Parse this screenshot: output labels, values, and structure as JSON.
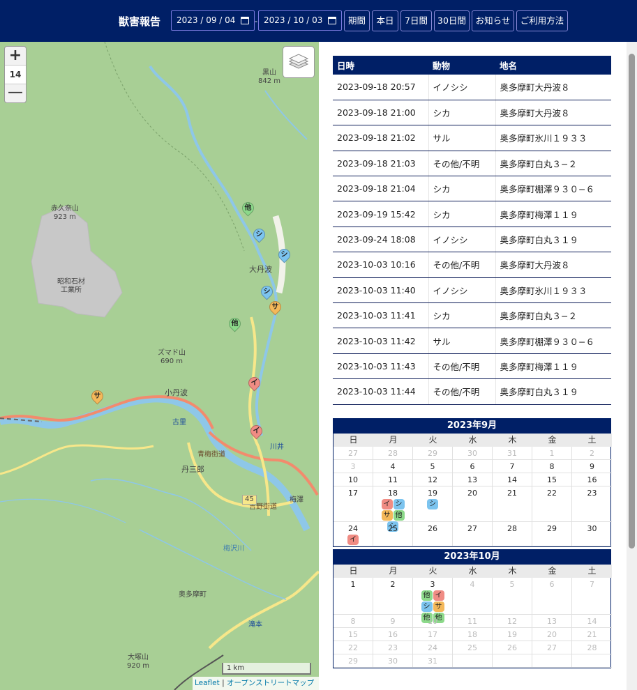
{
  "header": {
    "title": "獣害報告",
    "date_from": "2023 / 09 / 04",
    "date_separator": "-",
    "date_to": "2023 / 10 / 03",
    "buttons": [
      "期間",
      "本日",
      "7日間",
      "30日間",
      "お知らせ",
      "ご利用方法"
    ]
  },
  "map": {
    "zoom_in": "+",
    "zoom_level": "14",
    "zoom_out": "—",
    "labels": [
      {
        "text": "黒山",
        "sub": "842 m"
      },
      {
        "text": "赤久奈山",
        "sub": "923 m"
      },
      {
        "text": "昭和石材",
        "sub": "工業所"
      },
      {
        "text": "大丹波",
        "sub": ""
      },
      {
        "text": "ズマド山",
        "sub": "690 m"
      },
      {
        "text": "小丹波",
        "sub": ""
      },
      {
        "text": "古里",
        "sub": ""
      },
      {
        "text": "丹三郎",
        "sub": ""
      },
      {
        "text": "梅澤",
        "sub": ""
      },
      {
        "text": "梅沢川",
        "sub": ""
      },
      {
        "text": "奥多摩町",
        "sub": ""
      },
      {
        "text": "大塚山",
        "sub": "920 m"
      },
      {
        "text": "滝本",
        "sub": ""
      },
      {
        "text": "川井",
        "sub": ""
      },
      {
        "text": "青梅街道",
        "sub": ""
      },
      {
        "text": "吉野街道",
        "sub": ""
      },
      {
        "text": "45",
        "sub": ""
      }
    ],
    "markers": [
      {
        "ch": "他",
        "kind": "other"
      },
      {
        "ch": "シ",
        "kind": "deer"
      },
      {
        "ch": "シ",
        "kind": "deer"
      },
      {
        "ch": "シ",
        "kind": "deer"
      },
      {
        "ch": "サ",
        "kind": "monkey"
      },
      {
        "ch": "他",
        "kind": "other"
      },
      {
        "ch": "イ",
        "kind": "boar"
      },
      {
        "ch": "サ",
        "kind": "monkey"
      },
      {
        "ch": "イ",
        "kind": "boar"
      }
    ],
    "scale_label": "1 km",
    "attribution_link": "Leaflet",
    "attribution_sep": " | ",
    "attribution_osm": "オープンストリートマップ"
  },
  "colors": {
    "header_bg": "#001f66",
    "boar": "#f08c84",
    "deer": "#7cc4ef",
    "monkey": "#f4b85a",
    "other": "#8cd98a"
  },
  "reports": {
    "columns": [
      "日時",
      "動物",
      "地名"
    ],
    "rows": [
      [
        "2023-09-18 20:57",
        "イノシシ",
        "奥多摩町大丹波８"
      ],
      [
        "2023-09-18 21:00",
        "シカ",
        "奥多摩町大丹波８"
      ],
      [
        "2023-09-18 21:02",
        "サル",
        "奥多摩町氷川１９３３"
      ],
      [
        "2023-09-18 21:03",
        "その他/不明",
        "奥多摩町白丸３−２"
      ],
      [
        "2023-09-18 21:04",
        "シカ",
        "奥多摩町棚澤９３０−６"
      ],
      [
        "2023-09-19 15:42",
        "シカ",
        "奥多摩町梅澤１１９"
      ],
      [
        "2023-09-24 18:08",
        "イノシシ",
        "奥多摩町白丸３１９"
      ],
      [
        "2023-10-03 10:16",
        "その他/不明",
        "奥多摩町大丹波８"
      ],
      [
        "2023-10-03 11:40",
        "イノシシ",
        "奥多摩町氷川１９３３"
      ],
      [
        "2023-10-03 11:41",
        "シカ",
        "奥多摩町白丸３−２"
      ],
      [
        "2023-10-03 11:42",
        "サル",
        "奥多摩町棚澤９３０−６"
      ],
      [
        "2023-10-03 11:43",
        "その他/不明",
        "奥多摩町梅澤１１９"
      ],
      [
        "2023-10-03 11:44",
        "その他/不明",
        "奥多摩町白丸３１９"
      ]
    ]
  },
  "calendars": [
    {
      "title": "2023年9月",
      "weekdays": [
        "日",
        "月",
        "火",
        "水",
        "木",
        "金",
        "土"
      ],
      "rows": [
        [
          {
            "d": "27",
            "dim": true
          },
          {
            "d": "28",
            "dim": true
          },
          {
            "d": "29",
            "dim": true
          },
          {
            "d": "30",
            "dim": true
          },
          {
            "d": "31",
            "dim": true
          },
          {
            "d": "1",
            "dim": true
          },
          {
            "d": "2",
            "dim": true
          }
        ],
        [
          {
            "d": "3",
            "dim": true
          },
          {
            "d": "4"
          },
          {
            "d": "5"
          },
          {
            "d": "6"
          },
          {
            "d": "7"
          },
          {
            "d": "8"
          },
          {
            "d": "9"
          }
        ],
        [
          {
            "d": "10"
          },
          {
            "d": "11"
          },
          {
            "d": "12"
          },
          {
            "d": "13"
          },
          {
            "d": "14"
          },
          {
            "d": "15"
          },
          {
            "d": "16"
          }
        ],
        [
          {
            "d": "17"
          },
          {
            "d": "18",
            "b": [
              [
                "イ",
                "boar"
              ],
              [
                "シ",
                "deer"
              ],
              [
                "サ",
                "monkey"
              ],
              [
                "他",
                "other"
              ],
              [
                "シ",
                "deer"
              ]
            ]
          },
          {
            "d": "19",
            "b": [
              [
                "シ",
                "deer"
              ]
            ]
          },
          {
            "d": "20"
          },
          {
            "d": "21"
          },
          {
            "d": "22"
          },
          {
            "d": "23"
          }
        ],
        [
          {
            "d": "24",
            "b": [
              [
                "イ",
                "boar"
              ]
            ]
          },
          {
            "d": "25"
          },
          {
            "d": "26"
          },
          {
            "d": "27"
          },
          {
            "d": "28"
          },
          {
            "d": "29"
          },
          {
            "d": "30"
          }
        ]
      ]
    },
    {
      "title": "2023年10月",
      "weekdays": [
        "日",
        "月",
        "火",
        "水",
        "木",
        "金",
        "土"
      ],
      "rows": [
        [
          {
            "d": "1"
          },
          {
            "d": "2"
          },
          {
            "d": "3",
            "b": [
              [
                "他",
                "other"
              ],
              [
                "イ",
                "boar"
              ],
              [
                "シ",
                "deer"
              ],
              [
                "サ",
                "monkey"
              ],
              [
                "他",
                "other"
              ],
              [
                "他",
                "other"
              ]
            ]
          },
          {
            "d": "4",
            "dim": true
          },
          {
            "d": "5",
            "dim": true
          },
          {
            "d": "6",
            "dim": true
          },
          {
            "d": "7",
            "dim": true
          }
        ],
        [
          {
            "d": "8",
            "dim": true
          },
          {
            "d": "9",
            "dim": true
          },
          {
            "d": "10",
            "dim": true
          },
          {
            "d": "11",
            "dim": true
          },
          {
            "d": "12",
            "dim": true
          },
          {
            "d": "13",
            "dim": true
          },
          {
            "d": "14",
            "dim": true
          }
        ],
        [
          {
            "d": "15",
            "dim": true
          },
          {
            "d": "16",
            "dim": true
          },
          {
            "d": "17",
            "dim": true
          },
          {
            "d": "18",
            "dim": true
          },
          {
            "d": "19",
            "dim": true
          },
          {
            "d": "20",
            "dim": true
          },
          {
            "d": "21",
            "dim": true
          }
        ],
        [
          {
            "d": "22",
            "dim": true
          },
          {
            "d": "23",
            "dim": true
          },
          {
            "d": "24",
            "dim": true
          },
          {
            "d": "25",
            "dim": true
          },
          {
            "d": "26",
            "dim": true
          },
          {
            "d": "27",
            "dim": true
          },
          {
            "d": "28",
            "dim": true
          }
        ],
        [
          {
            "d": "29",
            "dim": true
          },
          {
            "d": "30",
            "dim": true
          },
          {
            "d": "31",
            "dim": true
          },
          {
            "d": "",
            "dim": true
          },
          {
            "d": "",
            "dim": true
          },
          {
            "d": "",
            "dim": true
          },
          {
            "d": "",
            "dim": true
          }
        ]
      ]
    }
  ]
}
